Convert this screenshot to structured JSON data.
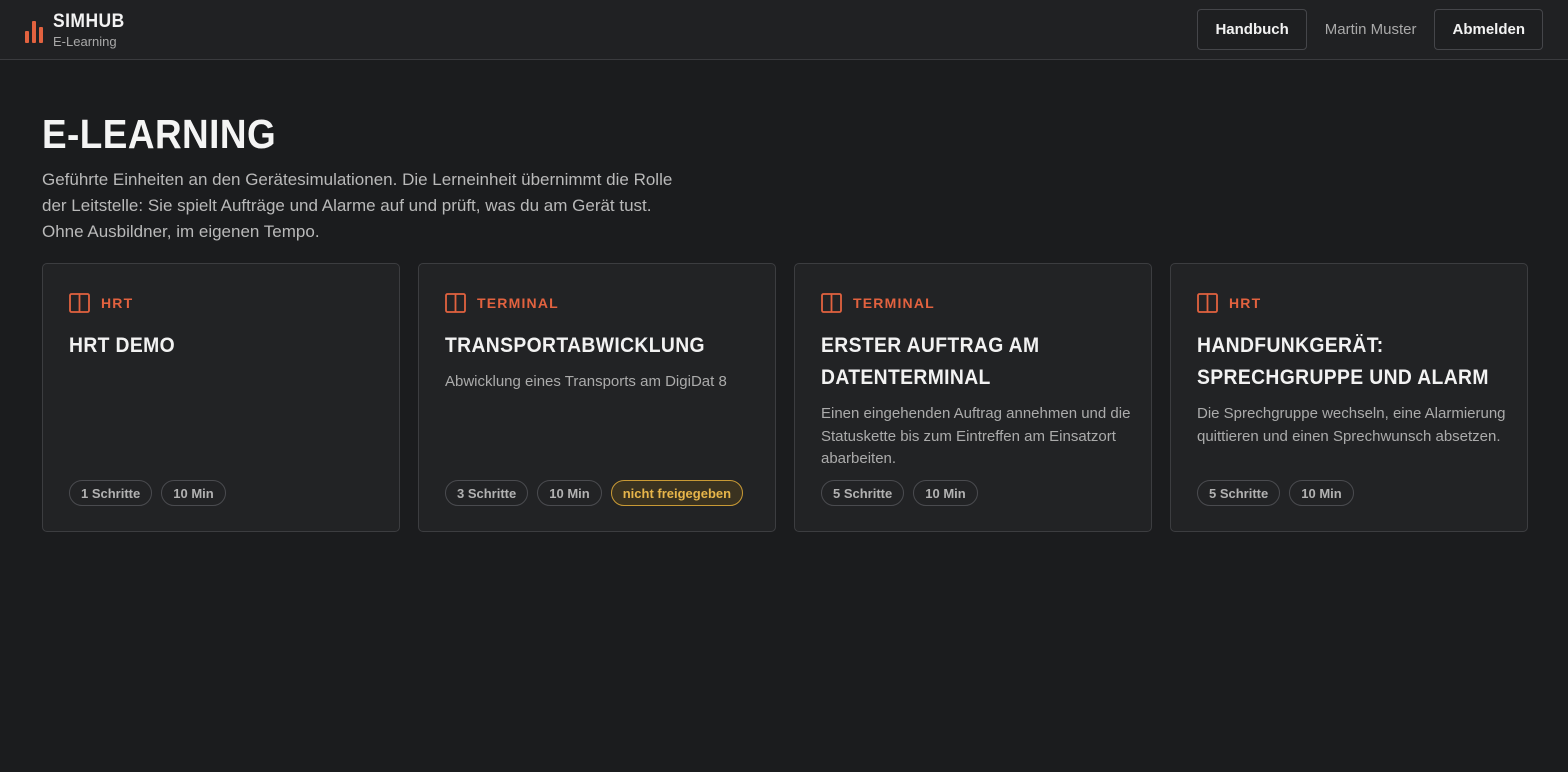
{
  "header": {
    "brand_title": "SIMHUB",
    "brand_subtitle": "E-Learning",
    "manual_label": "Handbuch",
    "user_name": "Martin Muster",
    "logout_label": "Abmelden"
  },
  "page": {
    "title": "E-LEARNING",
    "intro": "Geführte Einheiten an den Gerätesimulationen. Die Lerneinheit übernimmt die Rolle der Leitstelle: Sie spielt Aufträge und Alarme auf und prüft, was du am Gerät tust. Ohne Ausbildner, im eigenen Tempo."
  },
  "colors": {
    "accent": "#e2623f",
    "warning": "#e7b54a",
    "background": "#1b1c1e"
  },
  "cards": [
    {
      "category": "HRT",
      "title": "HRT DEMO",
      "description": "",
      "steps": "1 Schritte",
      "duration": "10 Min",
      "status": ""
    },
    {
      "category": "TERMINAL",
      "title": "TRANSPORTABWICKLUNG",
      "description": "Abwicklung eines Transports am DigiDat 8",
      "steps": "3 Schritte",
      "duration": "10 Min",
      "status": "nicht freigegeben"
    },
    {
      "category": "TERMINAL",
      "title": "ERSTER AUFTRAG AM DATENTERMINAL",
      "description": "Einen eingehenden Auftrag annehmen und die Statuskette bis zum Eintreffen am Einsatzort abarbeiten.",
      "steps": "5 Schritte",
      "duration": "10 Min",
      "status": ""
    },
    {
      "category": "HRT",
      "title": "HANDFUNKGERÄT: SPRECHGRUPPE UND ALARM",
      "description": "Die Sprechgruppe wechseln, eine Alarmierung quittieren und einen Sprechwunsch absetzen.",
      "steps": "5 Schritte",
      "duration": "10 Min",
      "status": ""
    }
  ]
}
